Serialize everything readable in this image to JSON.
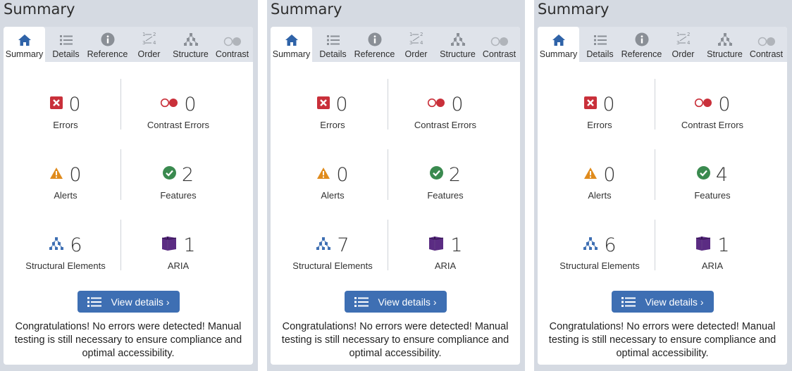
{
  "colors": {
    "error_red": "#c9303a",
    "alert_orange": "#e08b1c",
    "feature_green": "#3a8a4f",
    "struct_blue": "#3e6fb3",
    "aria_purple": "#5b2c83",
    "tab_icon_blue": "#2f63a8",
    "button_blue": "#3e6fb3"
  },
  "panels": [
    {
      "title": "Summary",
      "tabs": [
        {
          "label": "Summary",
          "icon": "home-icon",
          "active": true
        },
        {
          "label": "Details",
          "icon": "list-icon"
        },
        {
          "label": "Reference",
          "icon": "info-icon"
        },
        {
          "label": "Order",
          "icon": "order-icon"
        },
        {
          "label": "Structure",
          "icon": "structure-icon"
        },
        {
          "label": "Contrast",
          "icon": "contrast-icon"
        }
      ],
      "stats": {
        "errors": {
          "value": "0",
          "label": "Errors"
        },
        "contrast_errors": {
          "value": "0",
          "label": "Contrast Errors"
        },
        "alerts": {
          "value": "0",
          "label": "Alerts"
        },
        "features": {
          "value": "2",
          "label": "Features"
        },
        "structural": {
          "value": "6",
          "label": "Structural Elements"
        },
        "aria": {
          "value": "1",
          "label": "ARIA"
        }
      },
      "button_label": "View details ›",
      "message": "Congratulations! No errors were detected! Manual testing is still necessary to ensure compliance and optimal accessibility."
    },
    {
      "title": "Summary",
      "tabs": [
        {
          "label": "Summary",
          "icon": "home-icon",
          "active": true
        },
        {
          "label": "Details",
          "icon": "list-icon"
        },
        {
          "label": "Reference",
          "icon": "info-icon"
        },
        {
          "label": "Order",
          "icon": "order-icon"
        },
        {
          "label": "Structure",
          "icon": "structure-icon"
        },
        {
          "label": "Contrast",
          "icon": "contrast-icon"
        }
      ],
      "stats": {
        "errors": {
          "value": "0",
          "label": "Errors"
        },
        "contrast_errors": {
          "value": "0",
          "label": "Contrast Errors"
        },
        "alerts": {
          "value": "0",
          "label": "Alerts"
        },
        "features": {
          "value": "2",
          "label": "Features"
        },
        "structural": {
          "value": "7",
          "label": "Structural Elements"
        },
        "aria": {
          "value": "1",
          "label": "ARIA"
        }
      },
      "button_label": "View details ›",
      "message": "Congratulations! No errors were detected! Manual testing is still necessary to ensure compliance and optimal accessibility."
    },
    {
      "title": "Summary",
      "tabs": [
        {
          "label": "Summary",
          "icon": "home-icon",
          "active": true
        },
        {
          "label": "Details",
          "icon": "list-icon"
        },
        {
          "label": "Reference",
          "icon": "info-icon"
        },
        {
          "label": "Order",
          "icon": "order-icon"
        },
        {
          "label": "Structure",
          "icon": "structure-icon"
        },
        {
          "label": "Contrast",
          "icon": "contrast-icon"
        }
      ],
      "stats": {
        "errors": {
          "value": "0",
          "label": "Errors"
        },
        "contrast_errors": {
          "value": "0",
          "label": "Contrast Errors"
        },
        "alerts": {
          "value": "0",
          "label": "Alerts"
        },
        "features": {
          "value": "4",
          "label": "Features"
        },
        "structural": {
          "value": "6",
          "label": "Structural Elements"
        },
        "aria": {
          "value": "1",
          "label": "ARIA"
        }
      },
      "button_label": "View details ›",
      "message": "Congratulations! No errors were detected! Manual testing is still necessary to ensure compliance and optimal accessibility."
    }
  ]
}
